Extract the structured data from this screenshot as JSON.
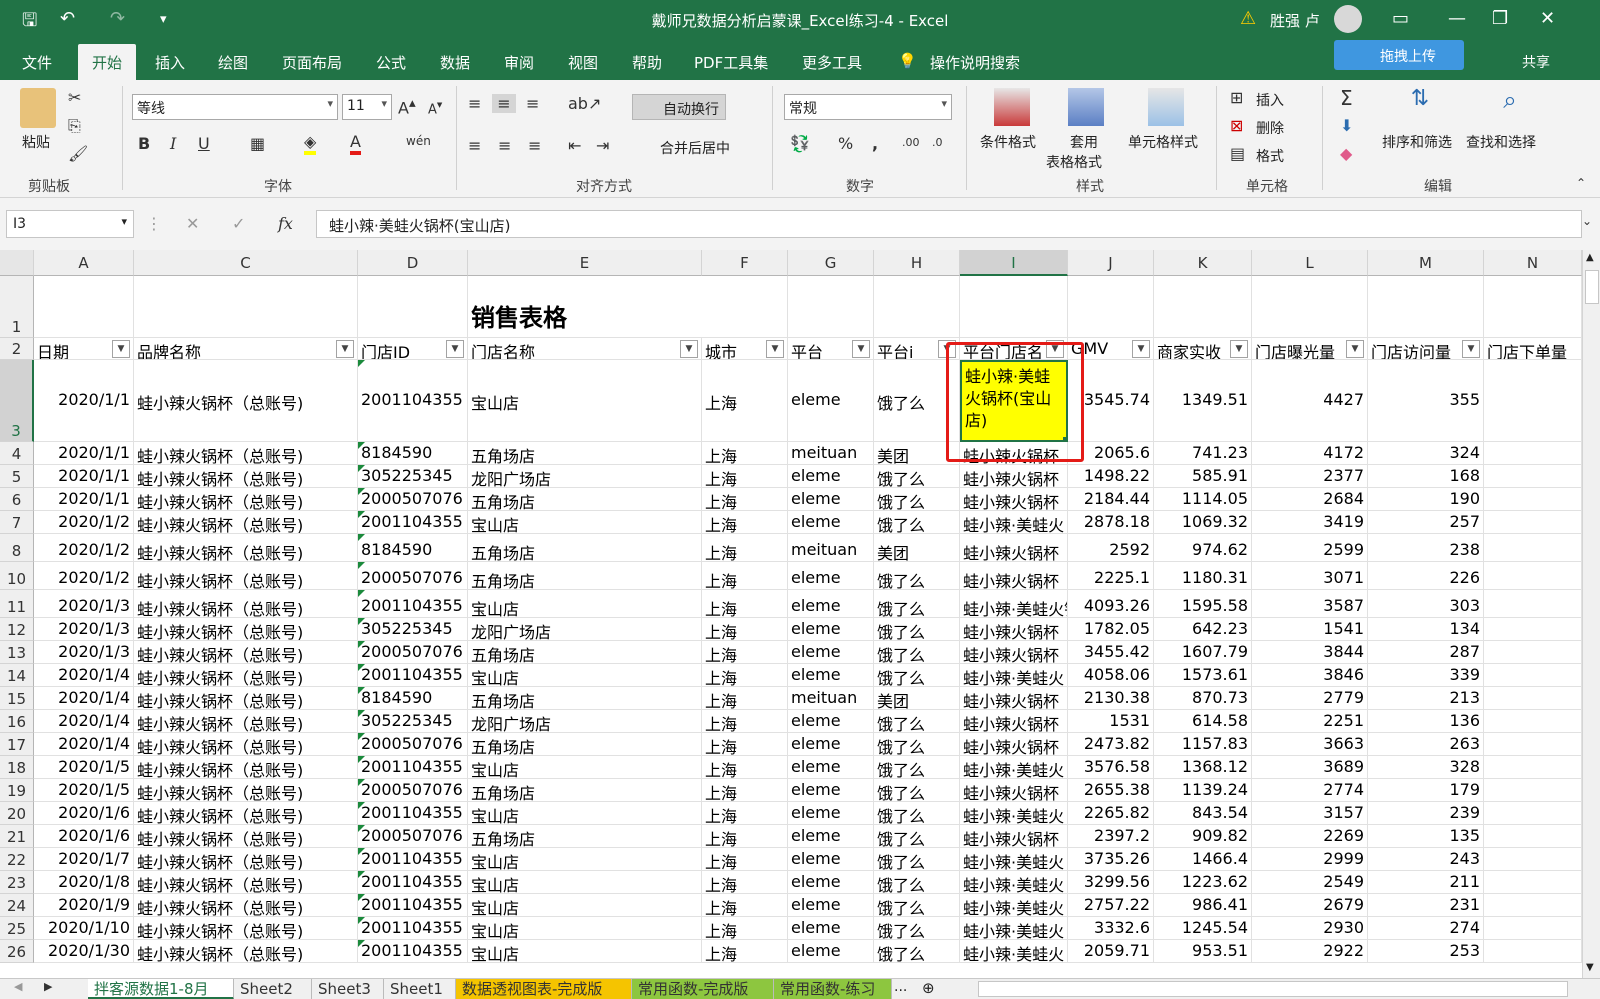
{
  "window": {
    "title": "戴师兄数据分析启蒙课_Excel练习-4  -  Excel",
    "user": "胜强 卢",
    "upload_button": "拖拽上传",
    "share": "共享"
  },
  "tabs": [
    "文件",
    "开始",
    "插入",
    "绘图",
    "页面布局",
    "公式",
    "数据",
    "审阅",
    "视图",
    "帮助",
    "PDF工具集",
    "更多工具",
    "操作说明搜索"
  ],
  "ribbon": {
    "clipboard": {
      "paste": "粘贴",
      "label": "剪贴板"
    },
    "font": {
      "name": "等线",
      "size": "11",
      "bold": "B",
      "italic": "I",
      "underline": "U",
      "label": "字体"
    },
    "align": {
      "wrap": "自动换行",
      "merge": "合并后居中",
      "label": "对齐方式"
    },
    "number": {
      "format": "常规",
      "percent": "%",
      "comma": ",",
      "label": "数字"
    },
    "styles": {
      "conditional": "条件格式",
      "table1": "套用",
      "table2": "表格格式",
      "cell_styles": "单元格样式",
      "label": "样式"
    },
    "cells": {
      "insert": "插入",
      "delete": "删除",
      "format": "格式",
      "label": "单元格"
    },
    "editing": {
      "sort": "排序和筛选",
      "find": "查找和选择",
      "label": "编辑"
    }
  },
  "formula_bar": {
    "name_box": "I3",
    "fx": "fx",
    "content": "蛙小辣·美蛙火锅杯(宝山店)"
  },
  "columns": [
    "A",
    "C",
    "D",
    "E",
    "F",
    "G",
    "H",
    "I",
    "J",
    "K",
    "L",
    "M",
    "N"
  ],
  "sheet_title": "销售表格",
  "headers": [
    "日期",
    "品牌名称",
    "门店ID",
    "门店名称",
    "城市",
    "平台",
    "平台i",
    "平台门店名",
    "GMV",
    "商家实收",
    "门店曝光量",
    "门店访问量",
    "门店下单量"
  ],
  "row3": {
    "row": "3",
    "date": "2020/1/1",
    "brand": "蛙小辣火锅杯（总账号)",
    "id": "2001104355",
    "store": "宝山店",
    "city": "上海",
    "platform": "eleme",
    "pi": "饿了么",
    "pstore_lines": [
      "蛙小辣·美蛙",
      "火锅杯(宝山",
      "店)"
    ],
    "gmv": "3545.74",
    "received": "1349.51",
    "exposure": "4427",
    "visits": "355"
  },
  "rows": [
    {
      "row": "4",
      "date": "2020/1/1",
      "brand": "蛙小辣火锅杯（总账号)",
      "id": "8184590",
      "store": "五角场店",
      "city": "上海",
      "platform": "meituan",
      "pi": "美团",
      "pstore": "蛙小辣火锅杯",
      "gmv": "2065.6",
      "received": "741.23",
      "exposure": "4172",
      "visits": "324"
    },
    {
      "row": "5",
      "date": "2020/1/1",
      "brand": "蛙小辣火锅杯（总账号)",
      "id": "305225345",
      "store": "龙阳广场店",
      "city": "上海",
      "platform": "eleme",
      "pi": "饿了么",
      "pstore": "蛙小辣火锅杯",
      "gmv": "1498.22",
      "received": "585.91",
      "exposure": "2377",
      "visits": "168"
    },
    {
      "row": "6",
      "date": "2020/1/1",
      "brand": "蛙小辣火锅杯（总账号)",
      "id": "2000507076",
      "store": "五角场店",
      "city": "上海",
      "platform": "eleme",
      "pi": "饿了么",
      "pstore": "蛙小辣火锅杯",
      "gmv": "2184.44",
      "received": "1114.05",
      "exposure": "2684",
      "visits": "190"
    },
    {
      "row": "7",
      "date": "2020/1/2",
      "brand": "蛙小辣火锅杯（总账号)",
      "id": "2001104355",
      "store": "宝山店",
      "city": "上海",
      "platform": "eleme",
      "pi": "饿了么",
      "pstore": "蛙小辣·美蛙火",
      "gmv": "2878.18",
      "received": "1069.32",
      "exposure": "3419",
      "visits": "257"
    },
    {
      "row": "8",
      "date": "2020/1/2",
      "brand": "蛙小辣火锅杯（总账号)",
      "id": "8184590",
      "store": "五角场店",
      "city": "上海",
      "platform": "meituan",
      "pi": "美团",
      "pstore": "蛙小辣火锅杯",
      "gmv": "2592",
      "received": "974.62",
      "exposure": "2599",
      "visits": "238"
    },
    {
      "row": "10",
      "date": "2020/1/2",
      "brand": "蛙小辣火锅杯（总账号)",
      "id": "2000507076",
      "store": "五角场店",
      "city": "上海",
      "platform": "eleme",
      "pi": "饿了么",
      "pstore": "蛙小辣火锅杯",
      "gmv": "2225.1",
      "received": "1180.31",
      "exposure": "3071",
      "visits": "226"
    },
    {
      "row": "11",
      "date": "2020/1/3",
      "brand": "蛙小辣火锅杯（总账号)",
      "id": "2001104355",
      "store": "宝山店",
      "city": "上海",
      "platform": "eleme",
      "pi": "饿了么",
      "pstore": "蛙小辣·美蛙火锅杯(宝山",
      "gmv": "4093.26",
      "received": "1595.58",
      "exposure": "3587",
      "visits": "303"
    },
    {
      "row": "12",
      "date": "2020/1/3",
      "brand": "蛙小辣火锅杯（总账号)",
      "id": "305225345",
      "store": "龙阳广场店",
      "city": "上海",
      "platform": "eleme",
      "pi": "饿了么",
      "pstore": "蛙小辣火锅杯",
      "gmv": "1782.05",
      "received": "642.23",
      "exposure": "1541",
      "visits": "134"
    },
    {
      "row": "13",
      "date": "2020/1/3",
      "brand": "蛙小辣火锅杯（总账号)",
      "id": "2000507076",
      "store": "五角场店",
      "city": "上海",
      "platform": "eleme",
      "pi": "饿了么",
      "pstore": "蛙小辣火锅杯",
      "gmv": "3455.42",
      "received": "1607.79",
      "exposure": "3844",
      "visits": "287"
    },
    {
      "row": "14",
      "date": "2020/1/4",
      "brand": "蛙小辣火锅杯（总账号)",
      "id": "2001104355",
      "store": "宝山店",
      "city": "上海",
      "platform": "eleme",
      "pi": "饿了么",
      "pstore": "蛙小辣·美蛙火",
      "gmv": "4058.06",
      "received": "1573.61",
      "exposure": "3846",
      "visits": "339"
    },
    {
      "row": "15",
      "date": "2020/1/4",
      "brand": "蛙小辣火锅杯（总账号)",
      "id": "8184590",
      "store": "五角场店",
      "city": "上海",
      "platform": "meituan",
      "pi": "美团",
      "pstore": "蛙小辣火锅杯",
      "gmv": "2130.38",
      "received": "870.73",
      "exposure": "2779",
      "visits": "213"
    },
    {
      "row": "16",
      "date": "2020/1/4",
      "brand": "蛙小辣火锅杯（总账号)",
      "id": "305225345",
      "store": "龙阳广场店",
      "city": "上海",
      "platform": "eleme",
      "pi": "饿了么",
      "pstore": "蛙小辣火锅杯",
      "gmv": "1531",
      "received": "614.58",
      "exposure": "2251",
      "visits": "136"
    },
    {
      "row": "17",
      "date": "2020/1/4",
      "brand": "蛙小辣火锅杯（总账号)",
      "id": "2000507076",
      "store": "五角场店",
      "city": "上海",
      "platform": "eleme",
      "pi": "饿了么",
      "pstore": "蛙小辣火锅杯",
      "gmv": "2473.82",
      "received": "1157.83",
      "exposure": "3663",
      "visits": "263"
    },
    {
      "row": "18",
      "date": "2020/1/5",
      "brand": "蛙小辣火锅杯（总账号)",
      "id": "2001104355",
      "store": "宝山店",
      "city": "上海",
      "platform": "eleme",
      "pi": "饿了么",
      "pstore": "蛙小辣·美蛙火",
      "gmv": "3576.58",
      "received": "1368.12",
      "exposure": "3689",
      "visits": "328"
    },
    {
      "row": "19",
      "date": "2020/1/5",
      "brand": "蛙小辣火锅杯（总账号)",
      "id": "2000507076",
      "store": "五角场店",
      "city": "上海",
      "platform": "eleme",
      "pi": "饿了么",
      "pstore": "蛙小辣火锅杯",
      "gmv": "2655.38",
      "received": "1139.24",
      "exposure": "2774",
      "visits": "179"
    },
    {
      "row": "20",
      "date": "2020/1/6",
      "brand": "蛙小辣火锅杯（总账号)",
      "id": "2001104355",
      "store": "宝山店",
      "city": "上海",
      "platform": "eleme",
      "pi": "饿了么",
      "pstore": "蛙小辣·美蛙火",
      "gmv": "2265.82",
      "received": "843.54",
      "exposure": "3157",
      "visits": "239"
    },
    {
      "row": "21",
      "date": "2020/1/6",
      "brand": "蛙小辣火锅杯（总账号)",
      "id": "2000507076",
      "store": "五角场店",
      "city": "上海",
      "platform": "eleme",
      "pi": "饿了么",
      "pstore": "蛙小辣火锅杯",
      "gmv": "2397.2",
      "received": "909.82",
      "exposure": "2269",
      "visits": "135"
    },
    {
      "row": "22",
      "date": "2020/1/7",
      "brand": "蛙小辣火锅杯（总账号)",
      "id": "2001104355",
      "store": "宝山店",
      "city": "上海",
      "platform": "eleme",
      "pi": "饿了么",
      "pstore": "蛙小辣·美蛙火",
      "gmv": "3735.26",
      "received": "1466.4",
      "exposure": "2999",
      "visits": "243"
    },
    {
      "row": "23",
      "date": "2020/1/8",
      "brand": "蛙小辣火锅杯（总账号)",
      "id": "2001104355",
      "store": "宝山店",
      "city": "上海",
      "platform": "eleme",
      "pi": "饿了么",
      "pstore": "蛙小辣·美蛙火",
      "gmv": "3299.56",
      "received": "1223.62",
      "exposure": "2549",
      "visits": "211"
    },
    {
      "row": "24",
      "date": "2020/1/9",
      "brand": "蛙小辣火锅杯（总账号)",
      "id": "2001104355",
      "store": "宝山店",
      "city": "上海",
      "platform": "eleme",
      "pi": "饿了么",
      "pstore": "蛙小辣·美蛙火",
      "gmv": "2757.22",
      "received": "986.41",
      "exposure": "2679",
      "visits": "231"
    },
    {
      "row": "25",
      "date": "2020/1/10",
      "brand": "蛙小辣火锅杯（总账号)",
      "id": "2001104355",
      "store": "宝山店",
      "city": "上海",
      "platform": "eleme",
      "pi": "饿了么",
      "pstore": "蛙小辣·美蛙火",
      "gmv": "3332.6",
      "received": "1245.54",
      "exposure": "2930",
      "visits": "274"
    },
    {
      "row": "26",
      "date": "2020/1/30",
      "brand": "蛙小辣火锅杯（总账号)",
      "id": "2001104355",
      "store": "宝山店",
      "city": "上海",
      "platform": "eleme",
      "pi": "饿了么",
      "pstore": "蛙小辣·美蛙火",
      "gmv": "2059.71",
      "received": "953.51",
      "exposure": "2922",
      "visits": "253"
    }
  ],
  "sheets": [
    {
      "name": "拌客源数据1-8月",
      "style": "active"
    },
    {
      "name": "Sheet2",
      "style": ""
    },
    {
      "name": "Sheet3",
      "style": ""
    },
    {
      "name": "Sheet1",
      "style": ""
    },
    {
      "name": "数据透视图表-完成版",
      "style": "orange"
    },
    {
      "name": "常用函数-完成版",
      "style": "green"
    },
    {
      "name": "常用函数-练习",
      "style": "green"
    }
  ],
  "colors": {
    "excel_green": "#217346",
    "highlight": "#ffff00",
    "red_box": "#e41b17"
  }
}
